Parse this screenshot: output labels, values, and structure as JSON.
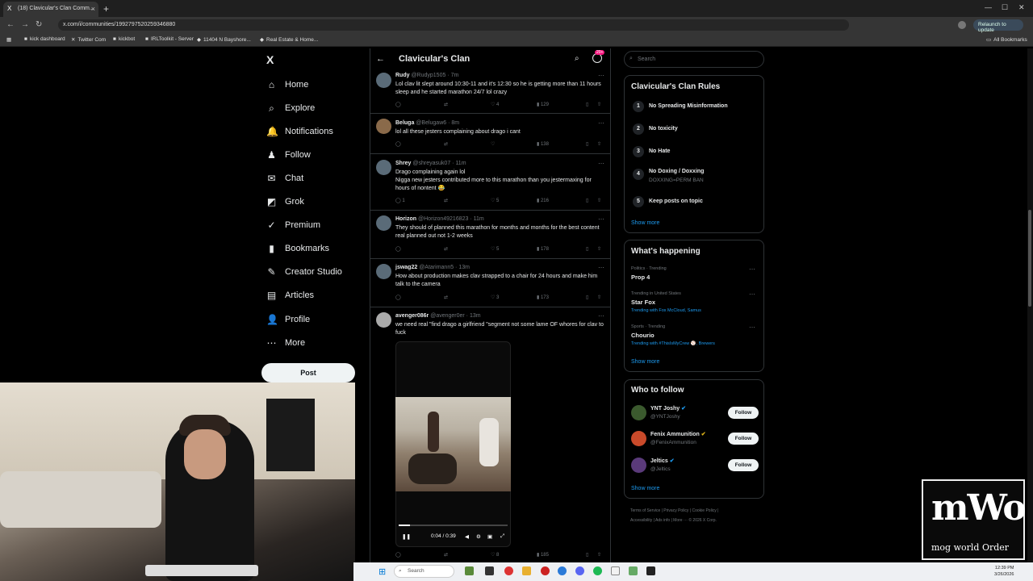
{
  "browser": {
    "tab_title": "(18) Clavicular's Clan Comm...",
    "tab_fav": "X",
    "url": "x.com/i/communities/1992797520259346880",
    "relaunch": "Relaunch to update",
    "all_bookmarks": "All Bookmarks",
    "bookmarks": [
      "kick dashboard",
      "Twitter Com",
      "kickbot",
      "IRLToolkit - Server",
      "11404 N Bayshore...",
      "Real Estate & Home..."
    ]
  },
  "nav": {
    "items": [
      {
        "label": "Home",
        "icon": "⌂"
      },
      {
        "label": "Explore",
        "icon": "⌕"
      },
      {
        "label": "Notifications",
        "icon": "🔔"
      },
      {
        "label": "Follow",
        "icon": "♟"
      },
      {
        "label": "Chat",
        "icon": "✉"
      },
      {
        "label": "Grok",
        "icon": "◩"
      },
      {
        "label": "Premium",
        "icon": "✓"
      },
      {
        "label": "Bookmarks",
        "icon": "▮"
      },
      {
        "label": "Creator Studio",
        "icon": "✎"
      },
      {
        "label": "Articles",
        "icon": "▤"
      },
      {
        "label": "Profile",
        "icon": "👤"
      },
      {
        "label": "More",
        "icon": "⋯"
      }
    ],
    "post": "Post",
    "logo": "X"
  },
  "community": {
    "title": "Clavicular's Clan",
    "badge": "20+"
  },
  "tweets": [
    {
      "name": "Rudy",
      "handle": "@Rudyp1505 · 7m",
      "text": "Lol clav lit slept around 10:30-11 and it's 12:30 so he is getting more than 11 hours sleep and he started marathon 24/7 lol crazy",
      "replies": "",
      "likes": "4",
      "views": "129"
    },
    {
      "name": "Beluga",
      "handle": "@Belugaw6 · 8m",
      "text": "lol all these jesters complaining about drago i cant",
      "replies": "",
      "likes": "",
      "views": "138"
    },
    {
      "name": "Shrey",
      "handle": "@shreyasuk07 · 11m",
      "text": "Drago complaining again lol\nNigga new jesters contributed more to this marathon than you jestermaxing for hours of nontent 😂",
      "replies": "1",
      "likes": "5",
      "views": "216"
    },
    {
      "name": "Horizon",
      "handle": "@Horizon49216823 · 11m",
      "text": "They should of planned this marathon for months  and months for the best content real planned out not 1-2 weeks",
      "replies": "",
      "likes": "5",
      "views": "178"
    },
    {
      "name": "jswag22",
      "handle": "@Atarimann5 · 13m",
      "text": "How about production makes clav strapped to a chair for 24 hours and make him talk to the camera",
      "replies": "",
      "likes": "3",
      "views": "173"
    },
    {
      "name": "avenger086r",
      "handle": "@avenger0er · 13m",
      "text": "we need real \"find drago a girlfriend \"segment not some lame OF whores for clav to fuck",
      "replies": "",
      "likes": "8",
      "views": "185"
    }
  ],
  "video": {
    "time": "0:04 / 0:39",
    "progress": 0.1
  },
  "search": {
    "placeholder": "Search"
  },
  "rules": {
    "title": "Clavicular's Clan Rules",
    "items": [
      {
        "n": "1",
        "text": "No Spreading Misinformation",
        "sub": ""
      },
      {
        "n": "2",
        "text": "No toxicity",
        "sub": ""
      },
      {
        "n": "3",
        "text": "No Hate",
        "sub": ""
      },
      {
        "n": "4",
        "text": "No Doxing / Doxxing",
        "sub": "DOXXING=PERM BAN"
      },
      {
        "n": "5",
        "text": "Keep posts on topic",
        "sub": ""
      }
    ],
    "show_more": "Show more"
  },
  "happening": {
    "title": "What's happening",
    "items": [
      {
        "meta": "Politics · Trending",
        "name": "Prop 4",
        "with": ""
      },
      {
        "meta": "Trending in United States",
        "name": "Star Fox",
        "with": "Trending with Fox McCloud, Samus"
      },
      {
        "meta": "Sports · Trending",
        "name": "Chourio",
        "with": "Trending with #ThisIsMyCrew ⚾, Brewers"
      }
    ],
    "show_more": "Show more"
  },
  "who_to_follow": {
    "title": "Who to follow",
    "items": [
      {
        "name": "YNT Joshy",
        "handle": "@YNTJoshy",
        "color": "#3b5a2e"
      },
      {
        "name": "Fenix Ammunition",
        "handle": "@FenixAmmunition",
        "color": "#c94a2a"
      },
      {
        "name": "Jeltics",
        "handle": "@Jeltics",
        "color": "#5a3a7a"
      }
    ],
    "button": "Follow",
    "show_more": "Show more"
  },
  "footer": {
    "line1": "Terms of Service  |  Privacy Policy  |  Cookie Policy  |",
    "line2": "Accessibility  |  Ads info  |  More ···  © 2026 X Corp."
  },
  "overlay": {
    "logo_big": "mWo",
    "logo_small": "mog world Order"
  },
  "taskbar": {
    "search": "Search",
    "time": "12:39 PM",
    "date": "3/26/2026"
  }
}
